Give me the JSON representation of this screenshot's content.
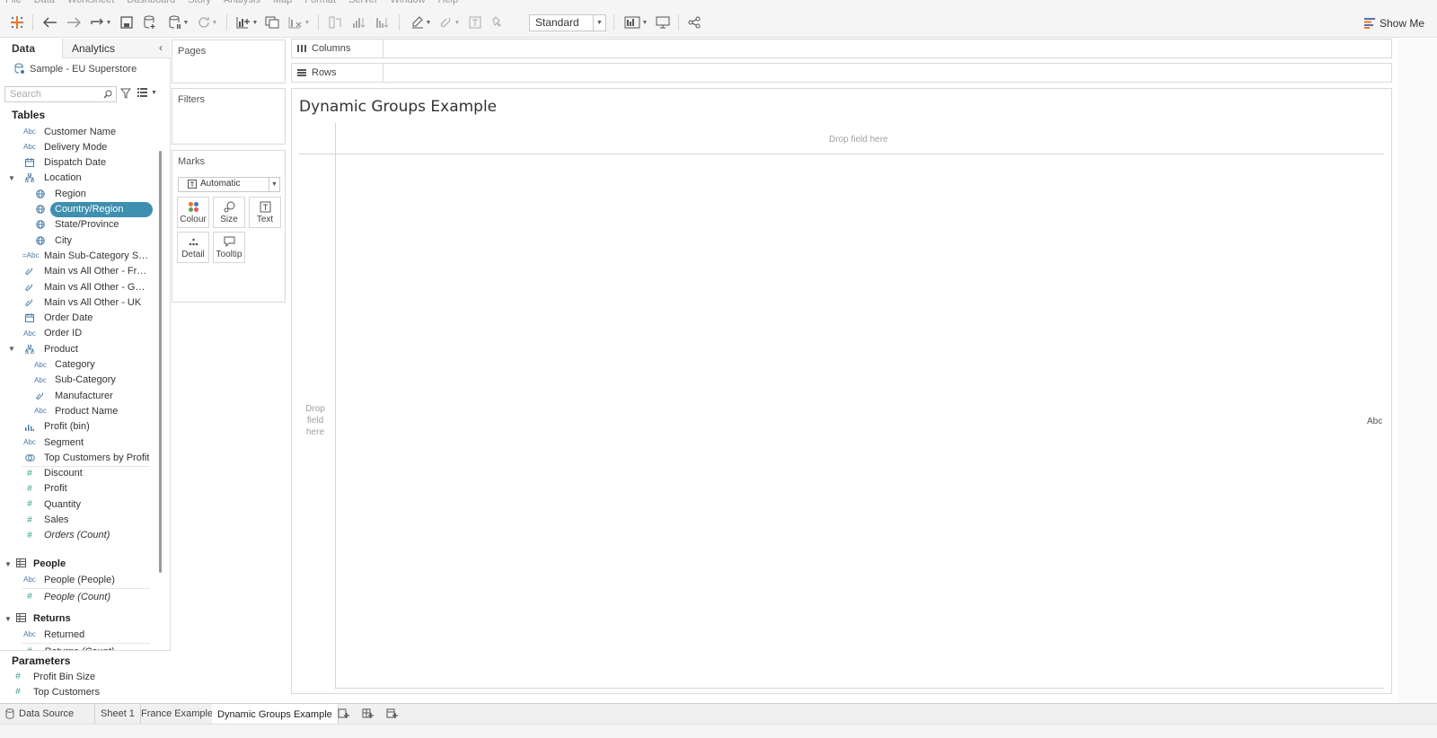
{
  "menu": [
    "File",
    "Data",
    "Worksheet",
    "Dashboard",
    "Story",
    "Analysis",
    "Map",
    "Format",
    "Server",
    "Window",
    "Help"
  ],
  "toolbar": {
    "fit_value": "Standard",
    "show_me_label": "Show Me"
  },
  "data_pane": {
    "tab_data": "Data",
    "tab_analytics": "Analytics",
    "datasource_name": "Sample - EU Superstore",
    "search_placeholder": "Search",
    "tables_header": "Tables",
    "fields": [
      {
        "label": "Customer Name",
        "icon": "Abc"
      },
      {
        "label": "Delivery Mode",
        "icon": "Abc"
      },
      {
        "label": "Dispatch Date",
        "icon": "calendar"
      },
      {
        "label": "Location",
        "icon": "hierarchy"
      },
      {
        "label": "Region",
        "icon": "globe"
      },
      {
        "label": "Country/Region",
        "icon": "globe",
        "selected": true
      },
      {
        "label": "State/Province",
        "icon": "globe"
      },
      {
        "label": "City",
        "icon": "globe"
      },
      {
        "label": "Main Sub-Category Sel...",
        "icon": "=Abc"
      },
      {
        "label": "Main vs All Other - France",
        "icon": "clip"
      },
      {
        "label": "Main vs All Other - Ger...",
        "icon": "clip"
      },
      {
        "label": "Main vs All Other - UK",
        "icon": "clip"
      },
      {
        "label": "Order Date",
        "icon": "calendar"
      },
      {
        "label": "Order ID",
        "icon": "Abc"
      },
      {
        "label": "Product",
        "icon": "hierarchy"
      },
      {
        "label": "Category",
        "icon": "Abc"
      },
      {
        "label": "Sub-Category",
        "icon": "Abc"
      },
      {
        "label": "Manufacturer",
        "icon": "clip"
      },
      {
        "label": "Product Name",
        "icon": "Abc"
      },
      {
        "label": "Profit (bin)",
        "icon": "bin"
      },
      {
        "label": "Segment",
        "icon": "Abc"
      },
      {
        "label": "Top Customers by Profit",
        "icon": "set"
      },
      {
        "label": "Discount",
        "icon": "#"
      },
      {
        "label": "Profit",
        "icon": "#"
      },
      {
        "label": "Quantity",
        "icon": "#"
      },
      {
        "label": "Sales",
        "icon": "#"
      },
      {
        "label": "Orders (Count)",
        "icon": "#"
      }
    ],
    "people_header": "People",
    "people_fields": [
      {
        "label": "People (People)",
        "icon": "Abc"
      },
      {
        "label": "People (Count)",
        "icon": "#"
      }
    ],
    "returns_header": "Returns",
    "returns_fields": [
      {
        "label": "Returned",
        "icon": "Abc"
      },
      {
        "label": "Returns (Count)",
        "icon": "#"
      }
    ],
    "parameters_header": "Parameters",
    "parameters": [
      {
        "label": "Profit Bin Size",
        "icon": "#"
      },
      {
        "label": "Top Customers",
        "icon": "#"
      }
    ]
  },
  "cards": {
    "pages": "Pages",
    "filters": "Filters",
    "marks": "Marks",
    "marks_type": "Automatic",
    "mark_buttons": [
      "Colour",
      "Size",
      "Text",
      "Detail",
      "Tooltip"
    ]
  },
  "shelves": {
    "columns": "Columns",
    "rows": "Rows"
  },
  "canvas": {
    "title": "Dynamic Groups Example",
    "drop_columns": "Drop field here",
    "drop_rows": "Drop field here",
    "mark_text": "Abc"
  },
  "sheet_tabs": {
    "data_source": "Data Source",
    "sheets": [
      "Sheet 1",
      "France Example",
      "Dynamic Groups Example"
    ],
    "active": "Dynamic Groups Example"
  },
  "colors": {
    "selected_pill": "#3e8fb0",
    "field_icon": "#4a7ba6"
  }
}
